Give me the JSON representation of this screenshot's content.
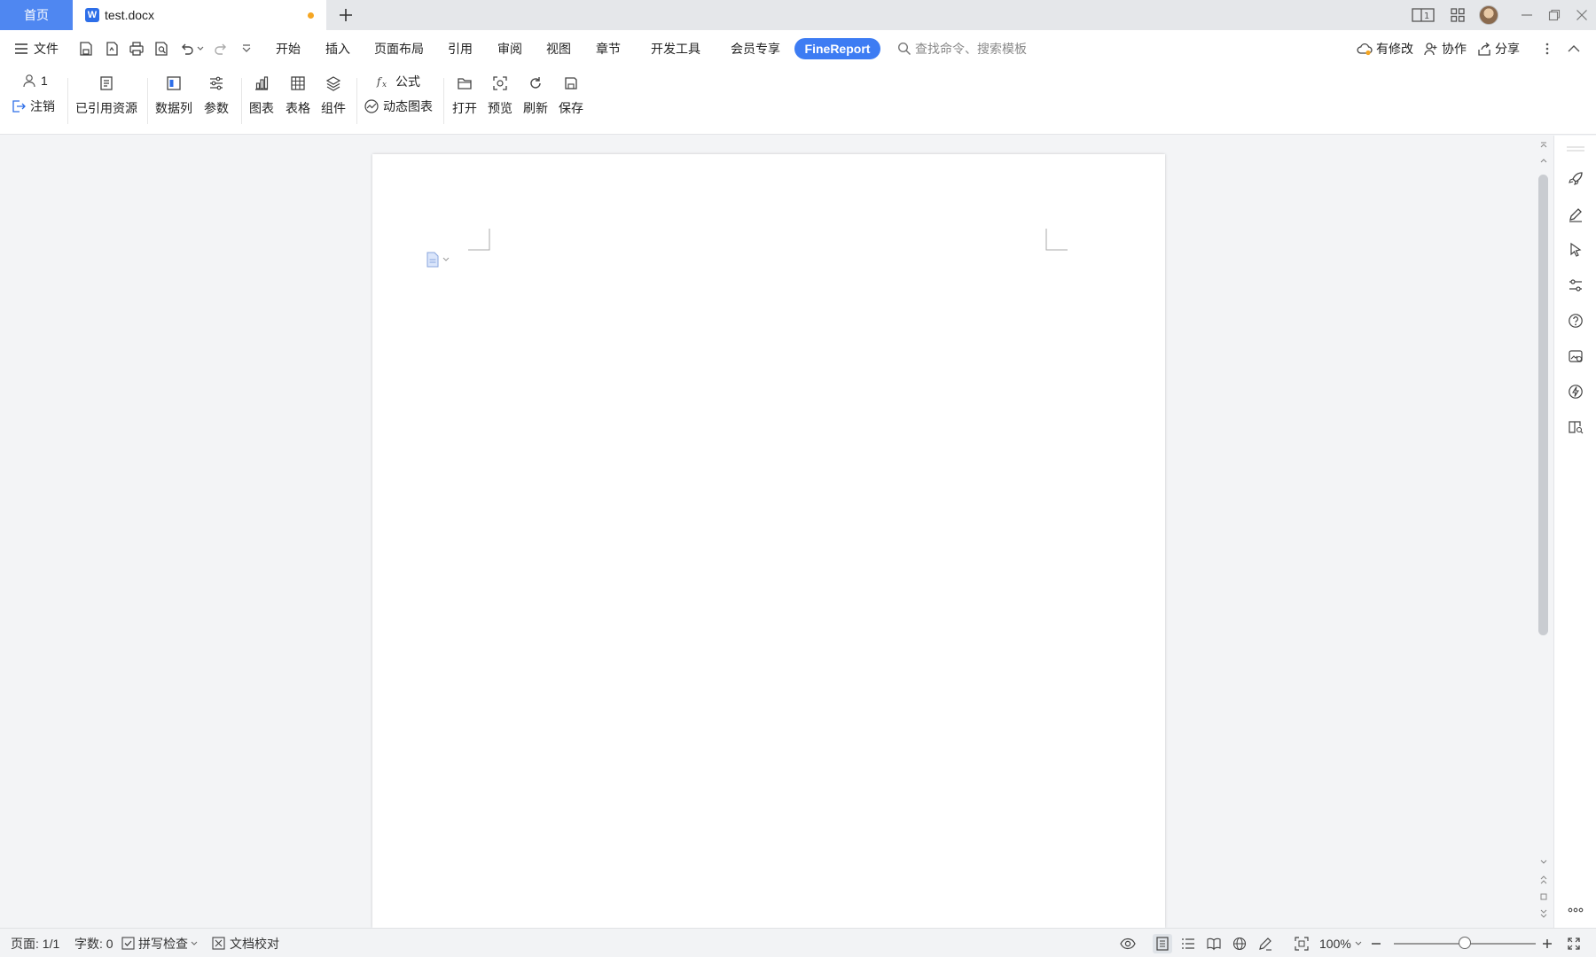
{
  "tabs": {
    "home": "首页",
    "document": "test.docx"
  },
  "menu": {
    "file": "文件",
    "items": [
      "开始",
      "插入",
      "页面布局",
      "引用",
      "审阅",
      "视图",
      "章节",
      "开发工具",
      "会员专享"
    ],
    "active": "FineReport",
    "search_placeholder": "查找命令、搜索模板",
    "modified": "有修改",
    "collaborate": "协作",
    "share": "分享"
  },
  "ribbon": {
    "user_count": "1",
    "logout": "注销",
    "referenced": "已引用资源",
    "datacol": "数据列",
    "params": "参数",
    "chart": "图表",
    "table": "表格",
    "component": "组件",
    "formula": "公式",
    "dynamic_chart": "动态图表",
    "open": "打开",
    "preview": "预览",
    "refresh": "刷新",
    "save": "保存"
  },
  "status": {
    "page": "页面: 1/1",
    "words": "字数: 0",
    "spell": "拼写检查",
    "proof": "文档校对",
    "zoom": "100%",
    "zoom_level": 0.5
  },
  "colors": {
    "accent": "#3d7cf3",
    "home_tab": "#4f87f1",
    "unsaved_dot": "#f5a623"
  }
}
